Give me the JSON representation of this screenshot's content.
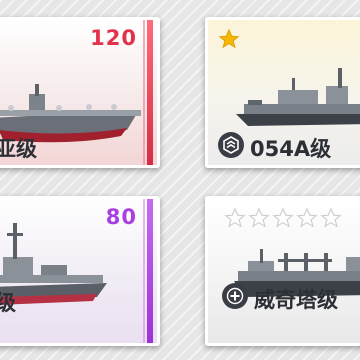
{
  "cards": [
    {
      "id": "carrier",
      "cost": "120",
      "name_label": "亚级",
      "rarity_color": "#e84a5f",
      "cost_color": "#e2324b"
    },
    {
      "id": "frigate",
      "stars_filled": 1,
      "stars_total": 1,
      "name_label": "054A级",
      "rarity_color": "#f2c230",
      "class_icon": "chevron-rank-icon"
    },
    {
      "id": "destroyer",
      "cost": "80",
      "name_label": "级",
      "rarity_color": "#b04ae0",
      "cost_color": "#a93fe0"
    },
    {
      "id": "supply-ship",
      "stars_filled": 0,
      "stars_total": 5,
      "name_label": "威奇塔级",
      "rarity_color": "#d8dde3",
      "class_icon": "plus-cross-icon"
    }
  ]
}
